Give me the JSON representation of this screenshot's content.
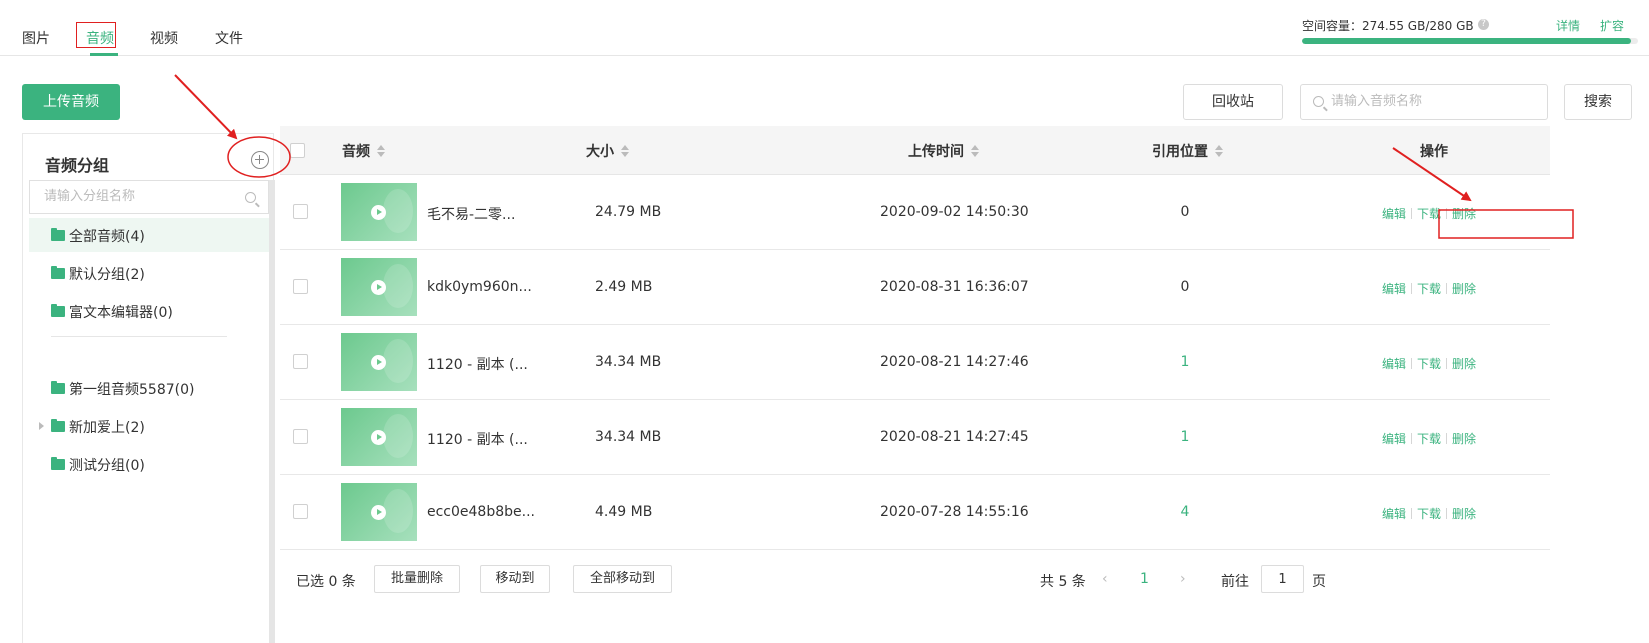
{
  "tabs": [
    {
      "label": "图片"
    },
    {
      "label": "音频"
    },
    {
      "label": "视频"
    },
    {
      "label": "文件"
    }
  ],
  "storage": {
    "label": "空间容量：274.55 GB/280 GB",
    "used_fraction": 0.9805,
    "detail_link": "详情",
    "expand_link": "扩容"
  },
  "toolbar": {
    "upload_label": "上传音频",
    "recycle_label": "回收站",
    "search_placeholder": "请输入音频名称",
    "search_button": "搜索"
  },
  "groups": {
    "title": "音频分组",
    "search_placeholder": "请输入分组名称",
    "items": [
      {
        "label": "全部音频(4)"
      },
      {
        "label": "默认分组(2)"
      },
      {
        "label": "富文本编辑器(0)"
      },
      {
        "label": "第一组音频5587(0)"
      },
      {
        "label": "新加爱上(2)"
      },
      {
        "label": "测试分组(0)"
      }
    ]
  },
  "table": {
    "headers": {
      "audio": "音频",
      "size": "大小",
      "upload_time": "上传时间",
      "reference": "引用位置",
      "actions": "操作"
    },
    "rows": [
      {
        "name": "毛不易-二零...",
        "size": "24.79 MB",
        "time": "2020-09-02 14:50:30",
        "ref": "0"
      },
      {
        "name": "kdk0ym960n...",
        "size": "2.49 MB",
        "time": "2020-08-31 16:36:07",
        "ref": "0"
      },
      {
        "name": "1120 - 副本 (...",
        "size": "34.34 MB",
        "time": "2020-08-21 14:27:46",
        "ref": "1"
      },
      {
        "name": "1120 - 副本 (...",
        "size": "34.34 MB",
        "time": "2020-08-21 14:27:45",
        "ref": "1"
      },
      {
        "name": "ecc0e48b8be...",
        "size": "4.49 MB",
        "time": "2020-07-28 14:55:16",
        "ref": "4"
      }
    ],
    "row_actions": {
      "edit": "编辑",
      "download": "下载",
      "delete": "删除"
    }
  },
  "footer": {
    "selected": "已选 0 条",
    "batch_delete": "批量删除",
    "move_to": "移动到",
    "move_all": "全部移动到",
    "total": "共 5 条",
    "prev": "‹",
    "current_page": "1",
    "next": "›",
    "goto_prefix": "前往",
    "goto_value": "1",
    "goto_suffix": "页"
  },
  "colors": {
    "accent": "#3bb37f",
    "annotation": "#e02020"
  },
  "icons": [
    "search-icon",
    "plus-circle-icon",
    "folder-icon",
    "play-icon",
    "sort-icon",
    "help-icon",
    "caret-right-icon"
  ]
}
